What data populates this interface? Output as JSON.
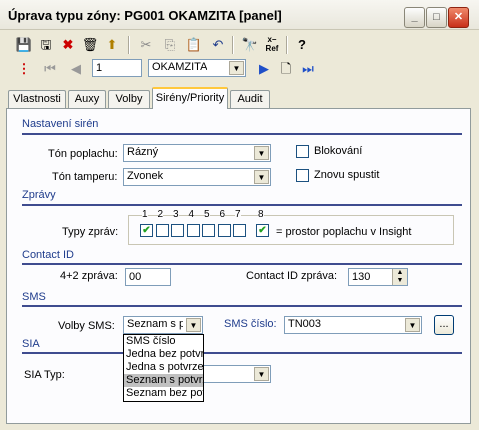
{
  "window": {
    "title": "Úprava typu zóny: PG001 OKAMZITA [panel]"
  },
  "toolbar1": {
    "icons": [
      "save-icon",
      "save-as-icon",
      "delete-icon",
      "trash-icon",
      "up-icon",
      "cut-icon",
      "copy-icon",
      "paste-icon",
      "undo-icon",
      "find-icon",
      "cross-ref-icon",
      "help-icon"
    ],
    "xref_label": "x–\nRef"
  },
  "toolbar2": {
    "record_value": "1",
    "record_combo": "OKAMZITA"
  },
  "tabs": [
    {
      "label": "Vlastnosti"
    },
    {
      "label": "Auxy"
    },
    {
      "label": "Volby"
    },
    {
      "label": "Sirény/Priority"
    },
    {
      "label": "Audit"
    }
  ],
  "sirens": {
    "title": "Nastavení sirén",
    "alarm_tone_label": "Tón poplachu:",
    "alarm_tone_value": "Rázný",
    "tamper_tone_label": "Tón tamperu:",
    "tamper_tone_value": "Zvonek",
    "blocking_label": "Blokování",
    "restart_label": "Znovu spustit"
  },
  "messages": {
    "title": "Zprávy",
    "types_label": "Typy zpráv:",
    "numbers": [
      "1",
      "2",
      "3",
      "4",
      "5",
      "6",
      "7",
      "8"
    ],
    "checked": [
      true,
      false,
      false,
      false,
      false,
      false,
      false,
      true
    ],
    "insight_label": "= prostor poplachu v Insight"
  },
  "contact_id": {
    "title": "Contact ID",
    "four_two_label": "4+2 zpráva:",
    "four_two_value": "00",
    "cid_label": "Contact ID zpráva:",
    "cid_value": "130"
  },
  "sms": {
    "title": "SMS",
    "options_label": "Volby SMS:",
    "options_value": "Seznam s p",
    "number_label": "SMS číslo:",
    "number_value": "TN003",
    "browse_label": "...",
    "dropdown": [
      "SMS číslo",
      "Jedna bez potvr",
      "Jedna s potvrzen",
      "Seznam s potvrz",
      "Seznam bez pot"
    ],
    "dropdown_selected": 3
  },
  "sia": {
    "title": "SIA",
    "type_label": "SIA Typ:",
    "type_value": ""
  }
}
